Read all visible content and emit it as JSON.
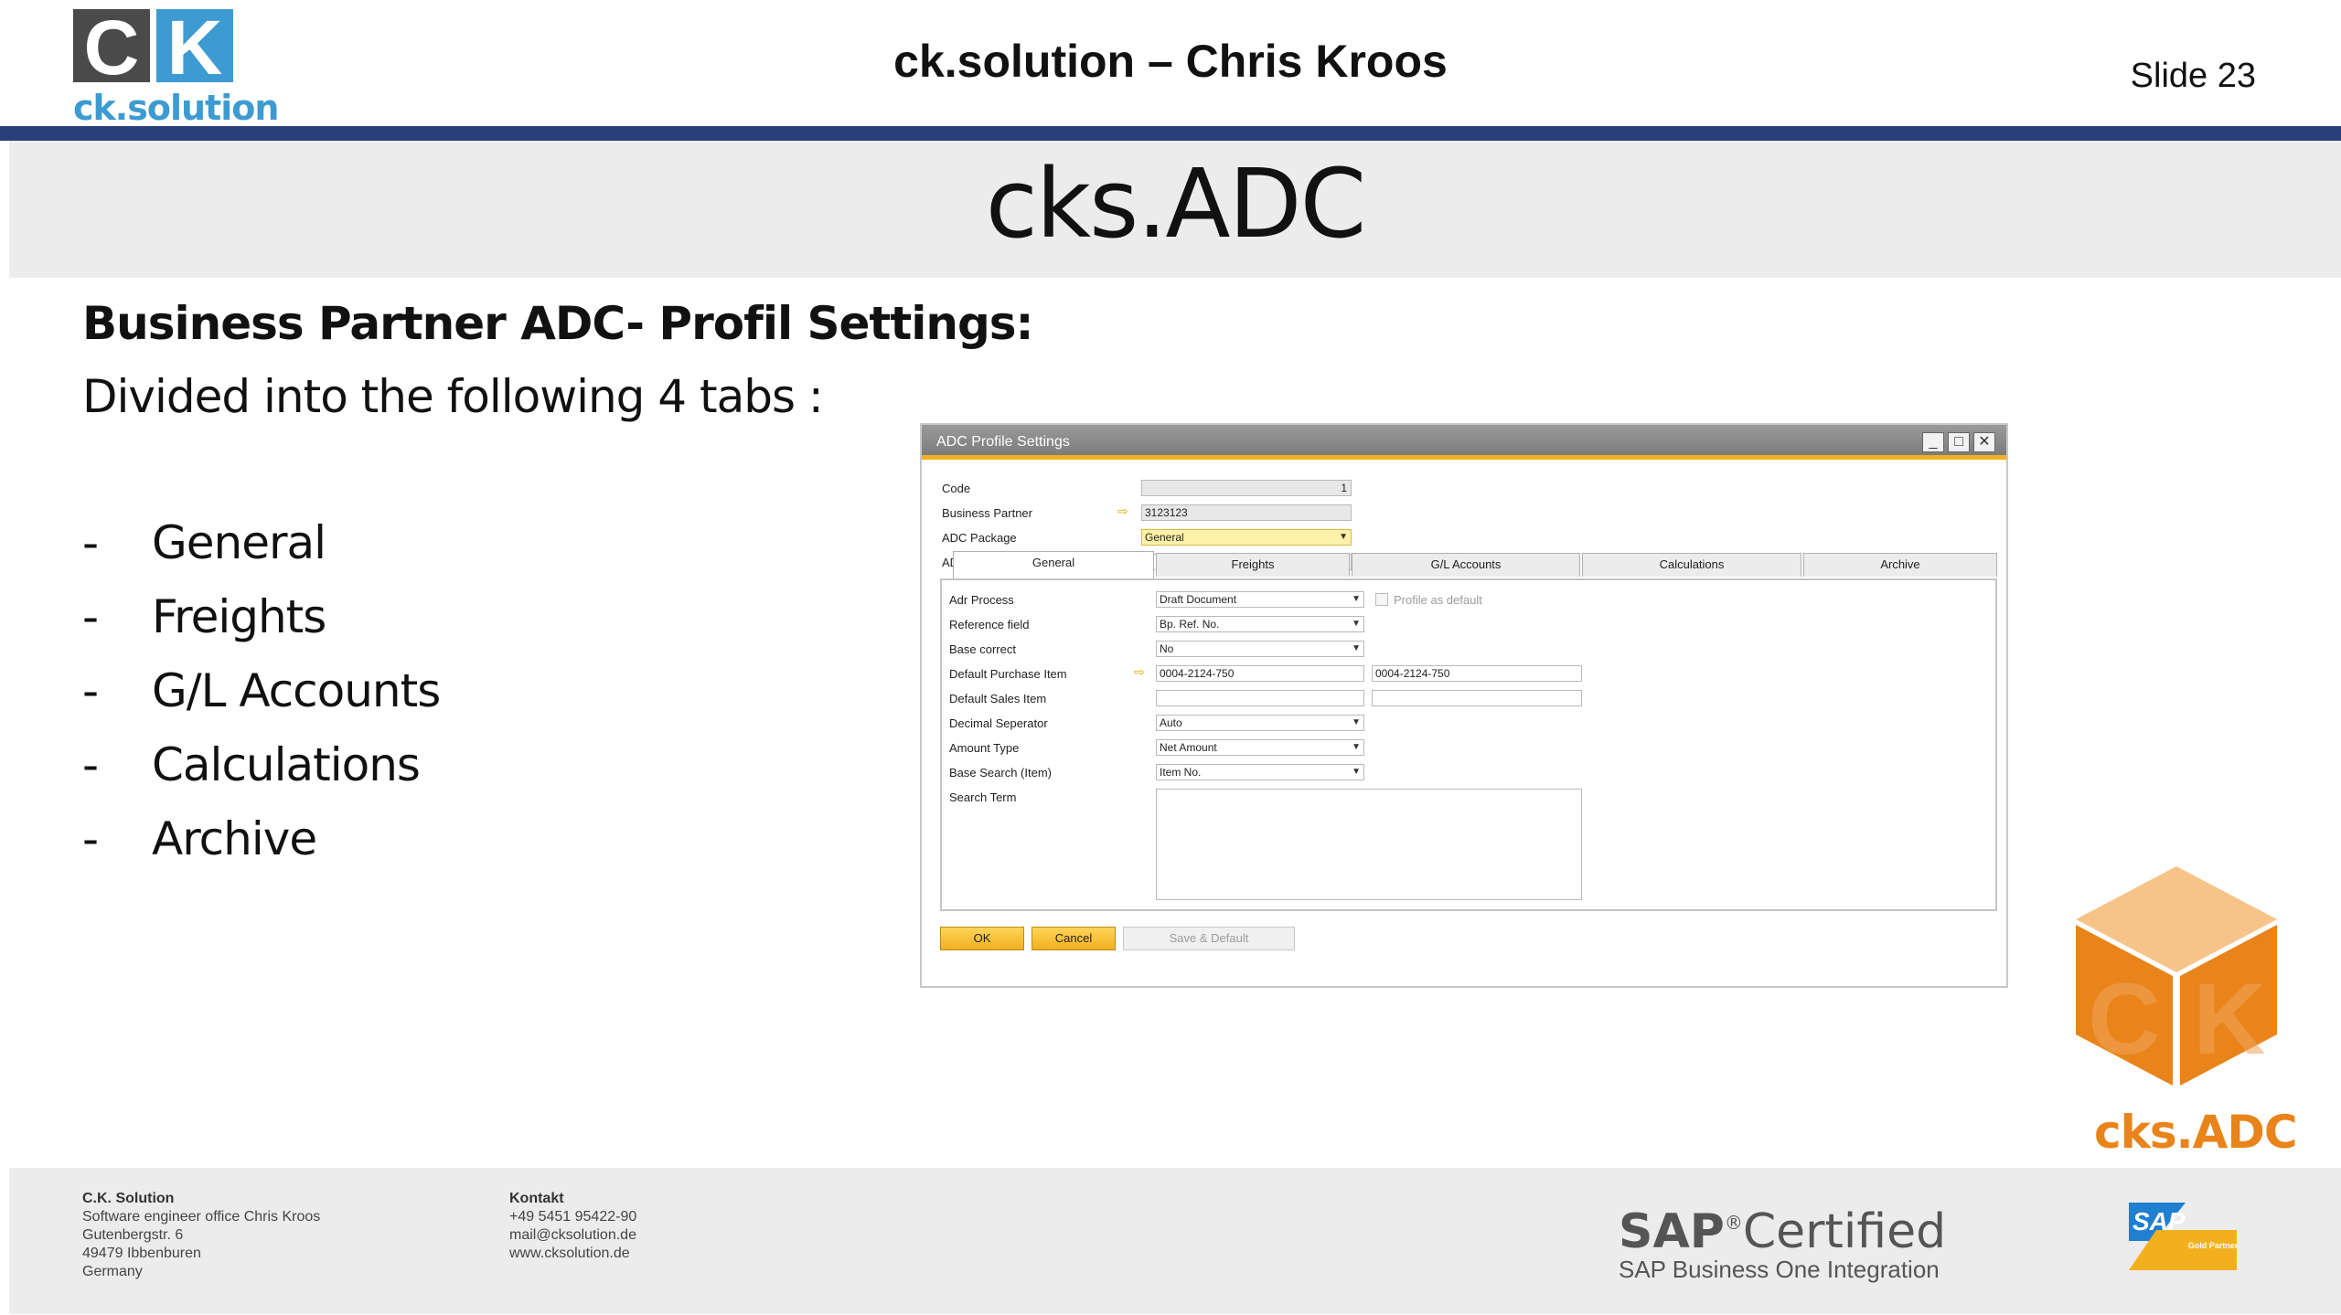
{
  "header": {
    "logo_letters": [
      "C",
      "K"
    ],
    "logo_text": "ck.solution",
    "title": "ck.solution – Chris Kroos",
    "slide_label": "Slide 23"
  },
  "title_band": {
    "title": "cks.ADC"
  },
  "content": {
    "subtitle": "Business Partner ADC- Profil Settings:",
    "intro": "Divided into the following 4 tabs :",
    "bullets": [
      {
        "dash": "-",
        "text": "General"
      },
      {
        "dash": "-",
        "text": "Freights"
      },
      {
        "dash": "-",
        "text": "G/L Accounts"
      },
      {
        "dash": "-",
        "text": "Calculations"
      },
      {
        "dash": "-",
        "text": "Archive"
      }
    ]
  },
  "window": {
    "title": "ADC Profile Settings",
    "controls": {
      "minimize": "_",
      "maximize": "□",
      "close": "✕"
    },
    "header_fields": {
      "code_label": "Code",
      "code_value": "1",
      "bp_label": "Business Partner",
      "bp_value": "3123123",
      "package_label": "ADC Package",
      "package_value": "General",
      "profile_label": "ADC Profile",
      "profile_value": ""
    },
    "tabs": [
      "General",
      "Freights",
      "G/L Accounts",
      "Calculations",
      "Archive"
    ],
    "general": {
      "adr_process_label": "Adr Process",
      "adr_process_value": "Draft Document",
      "profile_default_label": "Profile as default",
      "reference_label": "Reference field",
      "reference_value": "Bp. Ref. No.",
      "base_correct_label": "Base correct",
      "base_correct_value": "No",
      "default_purchase_label": "Default Purchase Item",
      "default_purchase_value": "0004-2124-750",
      "default_purchase_desc": "0004-2124-750",
      "default_sales_label": "Default Sales Item",
      "default_sales_value": "",
      "decimal_label": "Decimal Seperator",
      "decimal_value": "Auto",
      "amount_type_label": "Amount Type",
      "amount_type_value": "Net Amount",
      "base_search_label": "Base Search (Item)",
      "base_search_value": "Item No.",
      "search_term_label": "Search Term"
    },
    "buttons": {
      "ok": "OK",
      "cancel": "Cancel",
      "save_default": "Save & Default"
    }
  },
  "cube": {
    "label": "cks.ADC",
    "letters": "CK"
  },
  "footer": {
    "company": {
      "name": "C.K. Solution",
      "line1": "Software engineer office Chris Kroos",
      "line2": "Gutenbergstr. 6",
      "line3": "49479 Ibbenburen",
      "line4": "Germany"
    },
    "contact": {
      "heading": "Kontakt",
      "phone": "+49 5451 95422-90",
      "mail": "mail@cksolution.de",
      "web": "www.cksolution.de"
    },
    "sap": {
      "brand": "SAP",
      "reg": "®",
      "certified": "Certified",
      "integration": "SAP Business One Integration",
      "badge_text": "SAP",
      "badge_sub": "Gold Partner"
    }
  },
  "colors": {
    "header_rule": "#2a3f7a",
    "logo_blue": "#3d9bd1",
    "logo_grey": "#4a4a4a",
    "sap_yellow": "#f2b01e",
    "cube_orange": "#e8841a"
  }
}
